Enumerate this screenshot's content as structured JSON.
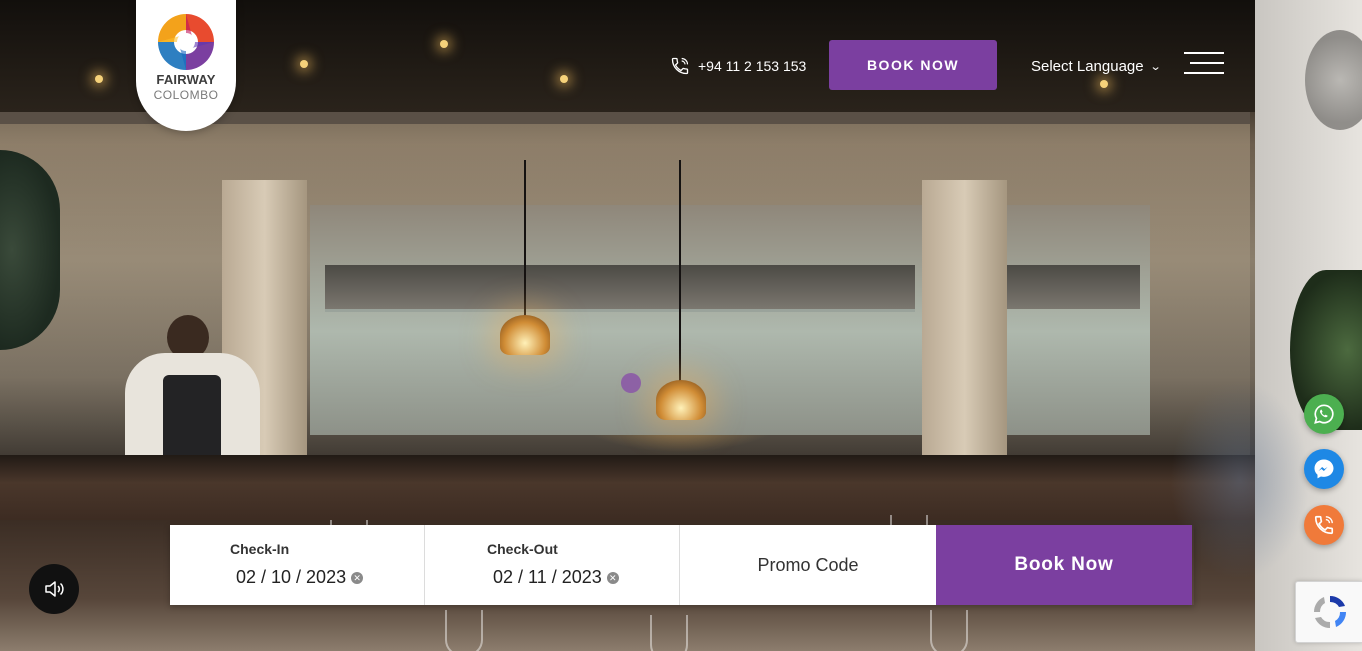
{
  "brand": {
    "name": "FAIRWAY",
    "city": "COLOMBO"
  },
  "header": {
    "phone": "+94 11 2 153 153",
    "book_now": "BOOK NOW",
    "language": "Select Language"
  },
  "booking": {
    "checkin_label": "Check-In",
    "checkin_value": "02 / 10 / 2023",
    "checkout_label": "Check-Out",
    "checkout_value": "02 / 11 / 2023",
    "promo": "Promo Code",
    "submit": "Book Now"
  },
  "icons": {
    "whatsapp": "whatsapp-icon",
    "messenger": "messenger-icon",
    "phone": "phone-icon",
    "sound": "speaker-icon",
    "recaptcha": "recaptcha-icon"
  },
  "colors": {
    "accent": "#7b3fa0",
    "whatsapp": "#4caf50",
    "messenger": "#1e88e5",
    "call": "#f07a3a"
  }
}
